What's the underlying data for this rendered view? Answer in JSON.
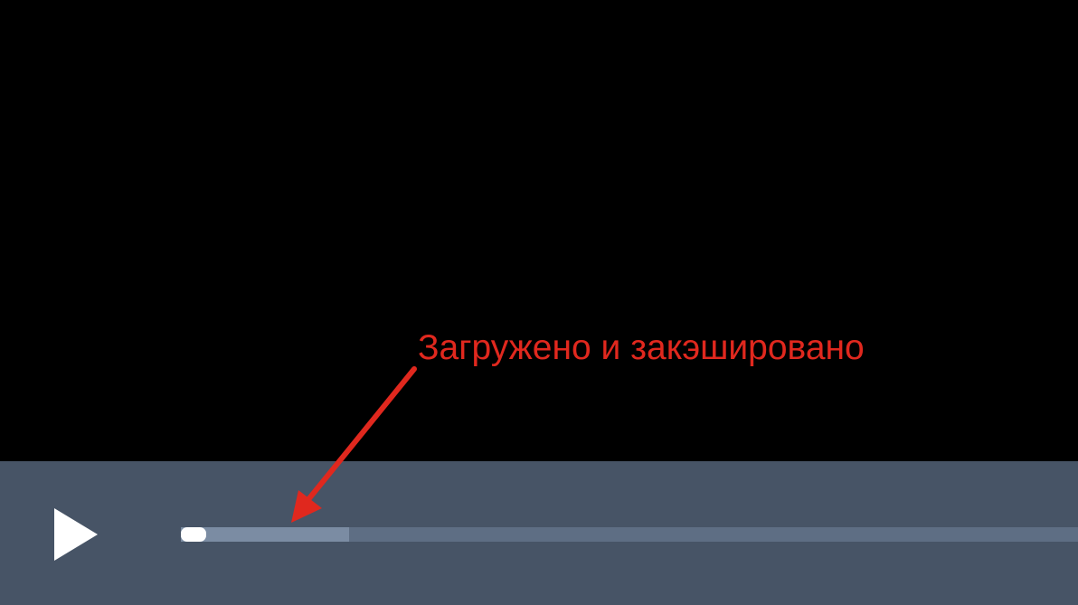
{
  "player": {
    "progress": {
      "played_fraction": 0.028,
      "buffered_fraction": 0.187
    },
    "play_icon": "play-icon"
  },
  "annotation": {
    "text": "Загружено и закэшировано",
    "color": "#e0281e"
  },
  "colors": {
    "video_background": "#000000",
    "control_bar": "#475466",
    "track": "#5e6e84",
    "buffered": "#7b8ca3",
    "played": "#ffffff"
  }
}
